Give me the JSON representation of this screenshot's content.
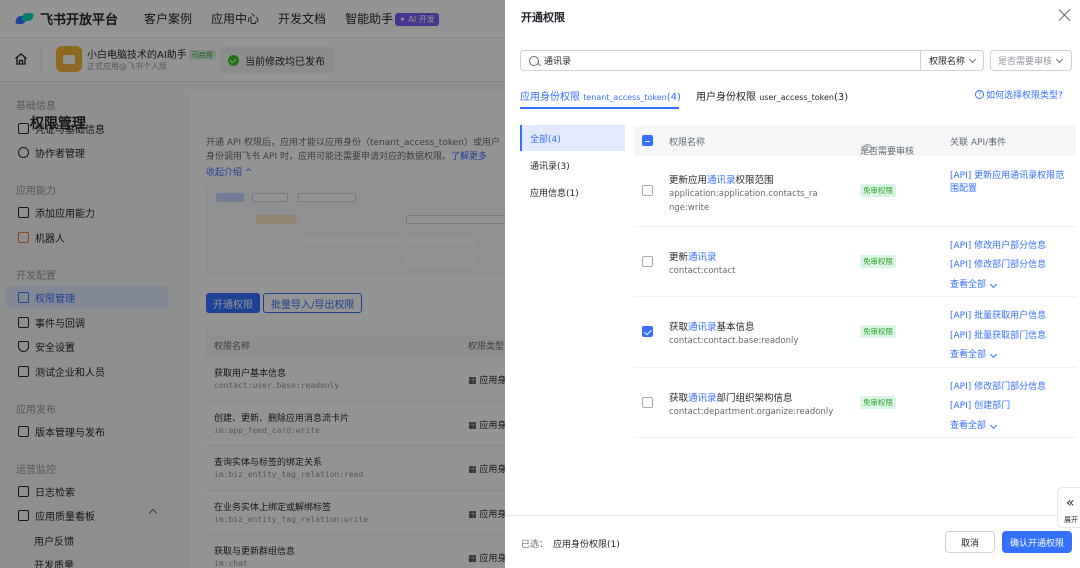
{
  "topbar": {
    "logo_text": "飞书开放平台",
    "nav": [
      "客户案例",
      "应用中心",
      "开发文档",
      "智能助手"
    ],
    "ai_badge": "✦ AI 开发"
  },
  "app": {
    "name": "小白电脑技术的AI助手",
    "enabled_badge": "已启用",
    "subtitle": "正式应用@飞书个人版",
    "publish_status": "当前修改均已发布"
  },
  "sidebar": {
    "groups": [
      {
        "title": "基础信息",
        "items": [
          "凭证与基础信息",
          "协作者管理"
        ]
      },
      {
        "title": "应用能力",
        "items": [
          "添加应用能力",
          "机器人"
        ]
      },
      {
        "title": "开发配置",
        "items": [
          "权限管理",
          "事件与回调",
          "安全设置",
          "测试企业和人员"
        ]
      },
      {
        "title": "应用发布",
        "items": [
          "版本管理与发布"
        ]
      },
      {
        "title": "运营监控",
        "items": [
          "日志检索",
          "应用质量看板",
          "用户反馈",
          "开发质量"
        ]
      }
    ]
  },
  "main": {
    "title": "权限管理",
    "desc": "开通 API 权限后，应用才能以应用身份（tenant_access_token）或用户身份调用飞书 API 时，应用可能还需要申请对应的数据权限。",
    "learn_more": "了解更多",
    "collapse": "收起介绍 ^",
    "btn_open": "开通权限",
    "btn_batch": "批量导入/导出权限",
    "table_head": [
      "权限名称",
      "权限类型"
    ],
    "rows": [
      {
        "name": "获取用户基本信息",
        "code": "contact:user.base:readonly",
        "type": "应用身"
      },
      {
        "name": "创建、更新、删除应用消息流卡片",
        "code": "im:app_feed_card:write",
        "type": "应用身"
      },
      {
        "name": "查询实体与标签的绑定关系",
        "code": "im:biz_entity_tag_relation:read",
        "type": "应用身"
      },
      {
        "name": "在业务实体上绑定或解绑标签",
        "code": "im:biz_entity_tag_relation:write",
        "type": "应用身"
      },
      {
        "name": "获取与更新群组信息",
        "code": "im:chat",
        "type": "应用身"
      }
    ]
  },
  "drawer": {
    "title": "开通权限",
    "search": {
      "value": "通讯录",
      "field_select": "权限名称",
      "filter_placeholder": "是否需要审核"
    },
    "tabs": [
      {
        "label": "应用身份权限",
        "token": "tenant_access_token",
        "count": "(4)"
      },
      {
        "label": "用户身份权限",
        "token": "user_access_token",
        "count": "(3)"
      }
    ],
    "help_link": "如何选择权限类型?",
    "categories": [
      "全部(4)",
      "通讯录(3)",
      "应用信息(1)"
    ],
    "columns": [
      "权限名称",
      "是否需要审核",
      "关联 API/事件"
    ],
    "rows": [
      {
        "name_pre": "更新应用",
        "name_hl": "通讯录",
        "name_post": "权限范围",
        "code": "application:application.contacts_range:write",
        "badge": "免审权限",
        "checked": false,
        "apis": [
          "[API] 更新应用通讯录权限范围配置"
        ],
        "view_all": ""
      },
      {
        "name_pre": "更新",
        "name_hl": "通讯录",
        "name_post": "",
        "code": "contact:contact",
        "badge": "免审权限",
        "checked": false,
        "apis": [
          "[API] 修改用户部分信息",
          "[API] 修改部门部分信息"
        ],
        "view_all": "查看全部"
      },
      {
        "name_pre": "获取",
        "name_hl": "通讯录",
        "name_post": "基本信息",
        "code": "contact:contact.base:readonly",
        "badge": "免审权限",
        "checked": true,
        "apis": [
          "[API] 批量获取用户信息",
          "[API] 批量获取部门信息"
        ],
        "view_all": "查看全部"
      },
      {
        "name_pre": "获取",
        "name_hl": "通讯录",
        "name_post": "部门组织架构信息",
        "code": "contact:department.organize:readonly",
        "badge": "免审权限",
        "checked": false,
        "apis": [
          "[API] 修改部门部分信息",
          "[API] 创建部门"
        ],
        "view_all": "查看全部"
      }
    ],
    "footer": {
      "selected_label": "已选：",
      "selected_value": "应用身份权限(1)",
      "cancel": "取消",
      "confirm": "确认开通权限"
    },
    "expand_label": "展开"
  },
  "colors": {
    "accent": "#3370ff",
    "success": "#2ea121",
    "success_bg": "#d9f5e4"
  }
}
